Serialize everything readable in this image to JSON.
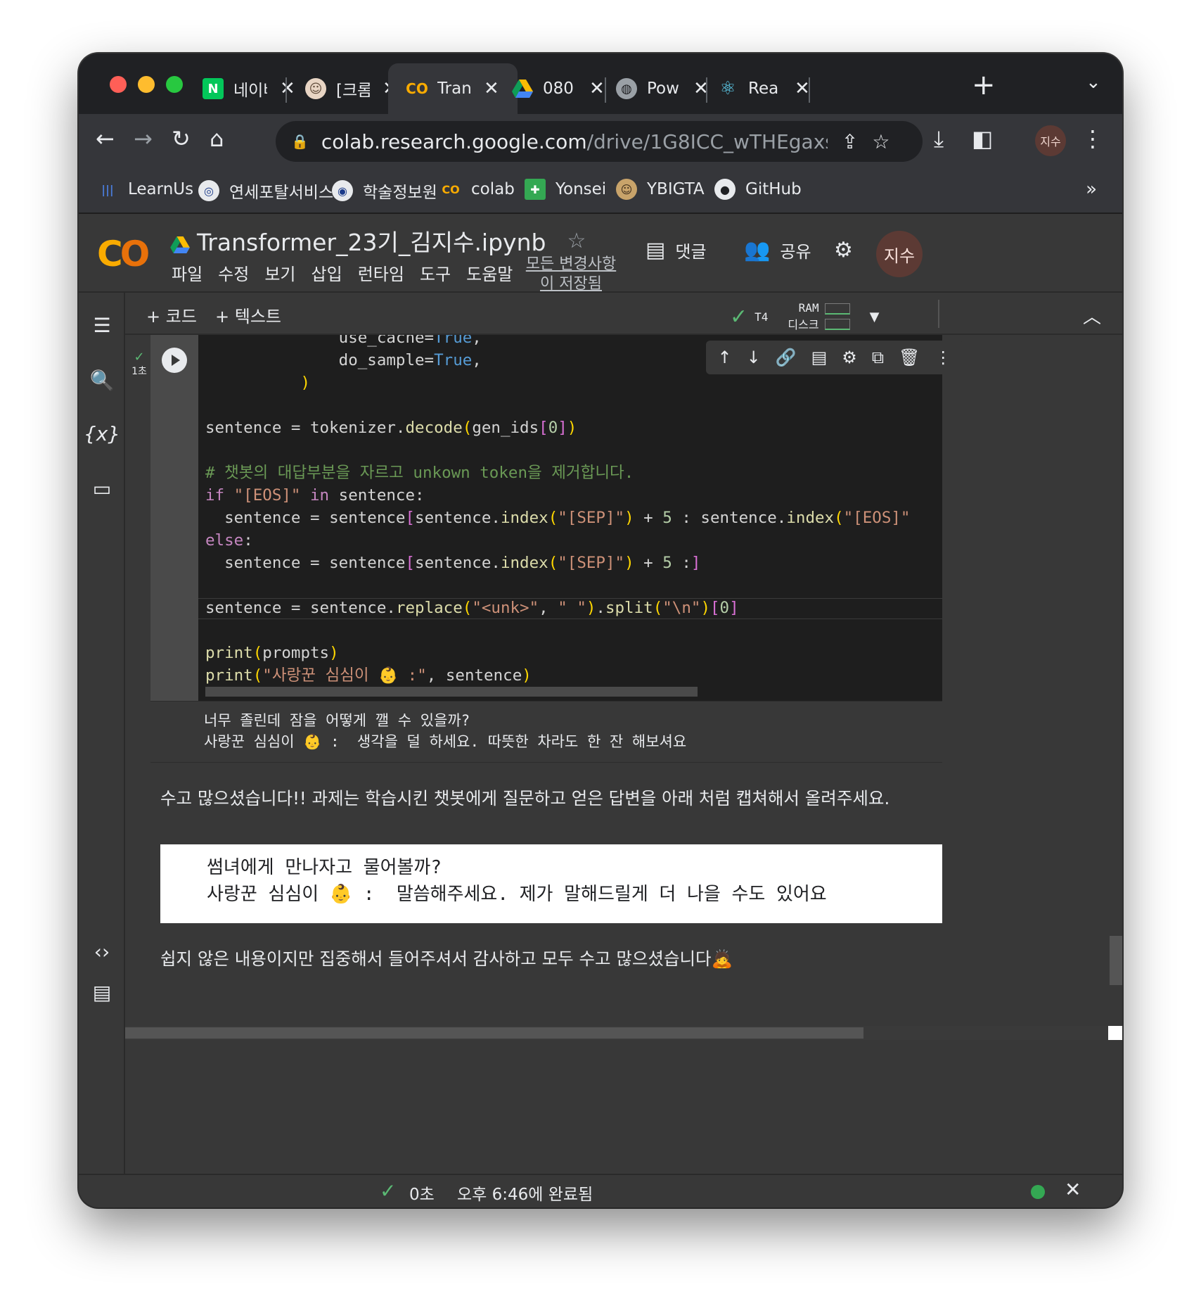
{
  "tabs": [
    {
      "title": "네이버",
      "icon": "naver-icon",
      "color": "#03c75a"
    },
    {
      "title": "[크롬",
      "icon": "face-icon",
      "color": "#5f4b3a"
    },
    {
      "title": "Tran",
      "icon": "colab-icon",
      "color": "#f9ab00"
    },
    {
      "title": "080",
      "icon": "drive-icon",
      "color": "#fbbc04"
    },
    {
      "title": "Pow",
      "icon": "globe-icon",
      "color": "#9aa0a6"
    },
    {
      "title": "Rea",
      "icon": "react-icon",
      "color": "#61dafb"
    }
  ],
  "address": {
    "host": "colab.research.google.com",
    "path": "/drive/1G8ICC_wTHEgaxs..."
  },
  "bookmarks": [
    "LearnUs",
    "연세포탈서비스",
    "학술정보원",
    "colab",
    "Yonsei",
    "YBIGTA",
    "GitHub"
  ],
  "profile": {
    "initials": "지수"
  },
  "notebook": {
    "title": "Transformer_23기_김지수.ipynb",
    "menus": [
      "파일",
      "수정",
      "보기",
      "삽입",
      "런타임",
      "도구",
      "도움말"
    ],
    "saved_status": "모든 변경사항이 저장됨",
    "comment_label": "댓글",
    "share_label": "공유",
    "add_code": "+ 코드",
    "add_text": "+ 텍스트",
    "runtime": {
      "gpu": "T4",
      "ram_label": "RAM",
      "disk_label": "디스크"
    }
  },
  "cell": {
    "exec_time": "1초",
    "code_lines": [
      "              use_cache=True,",
      "              do_sample=True,",
      "          )",
      "",
      "sentence = tokenizer.decode(gen_ids[0])",
      "",
      "# 챗봇의 대답부분을 자르고 unkown token을 제거합니다.",
      "if \"[EOS]\" in sentence:",
      "  sentence = sentence[sentence.index(\"[SEP]\") + 5 : sentence.index(\"[EOS]\"",
      "else:",
      "  sentence = sentence[sentence.index(\"[SEP]\") + 5 :]",
      "",
      "sentence = sentence.replace(\"<unk>\", \" \").split(\"\\n\")[0]",
      "",
      "print(prompts)",
      "print(\"사랑꾼 심심이 👶 :\", sentence)"
    ],
    "output_lines": [
      "너무 졸린데 잠을 어떻게 깰 수 있을까?",
      "사랑꾼 심심이 👶 :  생각을 덜 하세요. 따뜻한 차라도 한 잔 해보셔요"
    ]
  },
  "text_cells": {
    "instruction": "수고 많으셨습니다!! 과제는 학습시킨 챗봇에게 질문하고 얻은 답변을 아래 처럼 캡쳐해서 올려주세요.",
    "example_lines": [
      "썸녀에게 만나자고 물어볼까?",
      "사랑꾼 심심이 👶 :  말씀해주세요. 제가 말해드릴게 더 나을 수도 있어요"
    ],
    "closing": "쉽지 않은 내용이지만 집중해서 들어주셔서 감사하고 모두 수고 많으셨습니다🙇"
  },
  "status": {
    "duration": "0초",
    "completed": "오후 6:46에 완료됨"
  },
  "colors": {
    "accent": "#f9ab00",
    "ok": "#5bb974",
    "bg": "#383838"
  }
}
